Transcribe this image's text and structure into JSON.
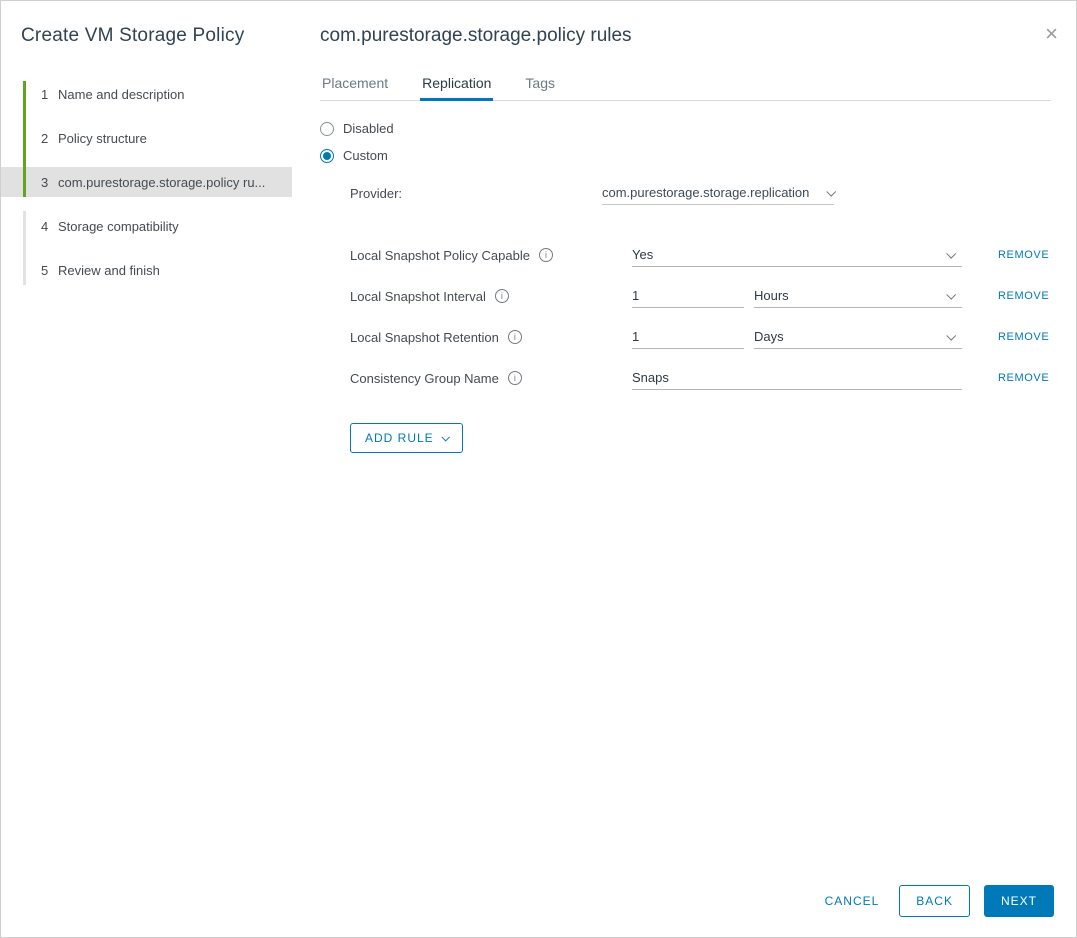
{
  "colors": {
    "accent": "#0079b8",
    "green": "#62a420"
  },
  "icons": {
    "close": "×",
    "info": "i"
  },
  "wizard": {
    "title": "Create VM Storage Policy",
    "steps": [
      {
        "num": "1",
        "label": "Name and description"
      },
      {
        "num": "2",
        "label": "Policy structure"
      },
      {
        "num": "3",
        "label": "com.purestorage.storage.policy ru..."
      },
      {
        "num": "4",
        "label": "Storage compatibility"
      },
      {
        "num": "5",
        "label": "Review and finish"
      }
    ]
  },
  "page": {
    "title": "com.purestorage.storage.policy rules"
  },
  "tabs": [
    {
      "label": "Placement"
    },
    {
      "label": "Replication"
    },
    {
      "label": "Tags"
    }
  ],
  "mode": {
    "disabled_label": "Disabled",
    "custom_label": "Custom",
    "selected": "Custom"
  },
  "provider": {
    "label": "Provider:",
    "value": "com.purestorage.storage.replication"
  },
  "rules": [
    {
      "label": "Local Snapshot Policy Capable",
      "value": "Yes",
      "remove_label": "REMOVE"
    },
    {
      "label": "Local Snapshot Interval",
      "value": "1",
      "unit": "Hours",
      "remove_label": "REMOVE"
    },
    {
      "label": "Local Snapshot Retention",
      "value": "1",
      "unit": "Days",
      "remove_label": "REMOVE"
    },
    {
      "label": "Consistency Group Name",
      "value": "Snaps",
      "remove_label": "REMOVE"
    }
  ],
  "add_rule_label": "ADD RULE",
  "footer": {
    "cancel_label": "CANCEL",
    "back_label": "BACK",
    "next_label": "NEXT"
  }
}
